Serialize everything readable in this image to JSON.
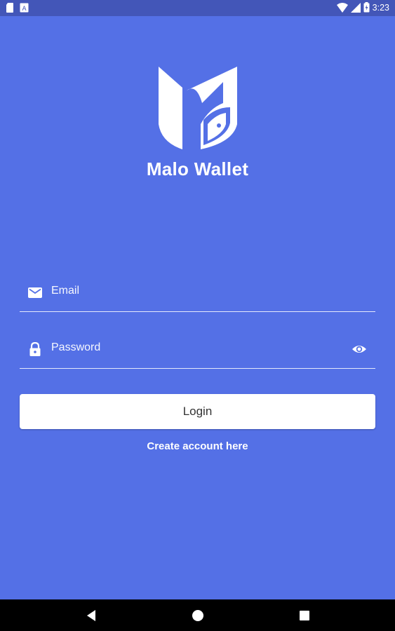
{
  "status_bar": {
    "time": "3:23"
  },
  "app": {
    "name": "Malo Wallet",
    "brand_color": "#5470E6",
    "status_color": "#4356B8"
  },
  "form": {
    "email_placeholder": "Email",
    "email_value": "",
    "password_placeholder": "Password",
    "password_value": "",
    "login_label": "Login",
    "create_account_label": "Create account here"
  },
  "icons": {
    "email": "mail-icon",
    "password": "lock-icon",
    "toggle_password": "eye-icon",
    "nav_back": "back-icon",
    "nav_home": "home-icon",
    "nav_recents": "recents-icon"
  }
}
